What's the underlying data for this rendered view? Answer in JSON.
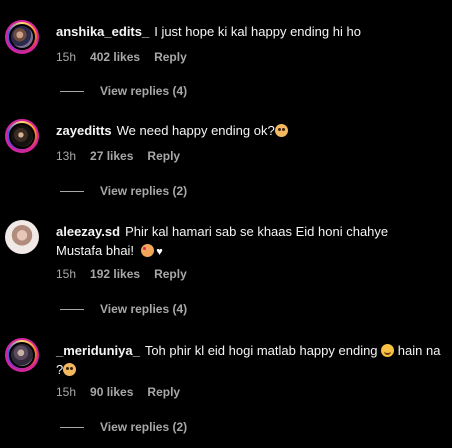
{
  "comments": [
    {
      "username": "anshika_edits_",
      "text": "I just hope ki kal happy ending hi ho",
      "time": "15h",
      "likes": "402 likes",
      "reply": "Reply",
      "view_replies": "View replies (4)"
    },
    {
      "username": "zayeditts",
      "text": "We need happy ending ok?",
      "emoji": "pleading-face-icon",
      "time": "13h",
      "likes": "27 likes",
      "reply": "Reply",
      "view_replies": "View replies (2)"
    },
    {
      "username": "aleezay.sd",
      "text": "Phir kal hamari sab se khaas Eid honi chahye Mustafa bhai!",
      "emoji": "smiling-face-with-hearts-icon",
      "heart": "♥",
      "time": "15h",
      "likes": "192 likes",
      "reply": "Reply",
      "view_replies": "View replies (4)"
    },
    {
      "username": "_meriduniya_",
      "text_a": "Toh phir kl eid hogi matlab happy ending",
      "text_b": "hain na ?",
      "emoji_a": "smiling-face-icon",
      "emoji_b": "pleading-face-icon",
      "time": "15h",
      "likes": "90 likes",
      "reply": "Reply",
      "view_replies": "View replies (2)"
    }
  ],
  "colors": {
    "background": "#000000",
    "primary_text": "#f5f5f5",
    "secondary_text": "#a8a8a8"
  }
}
